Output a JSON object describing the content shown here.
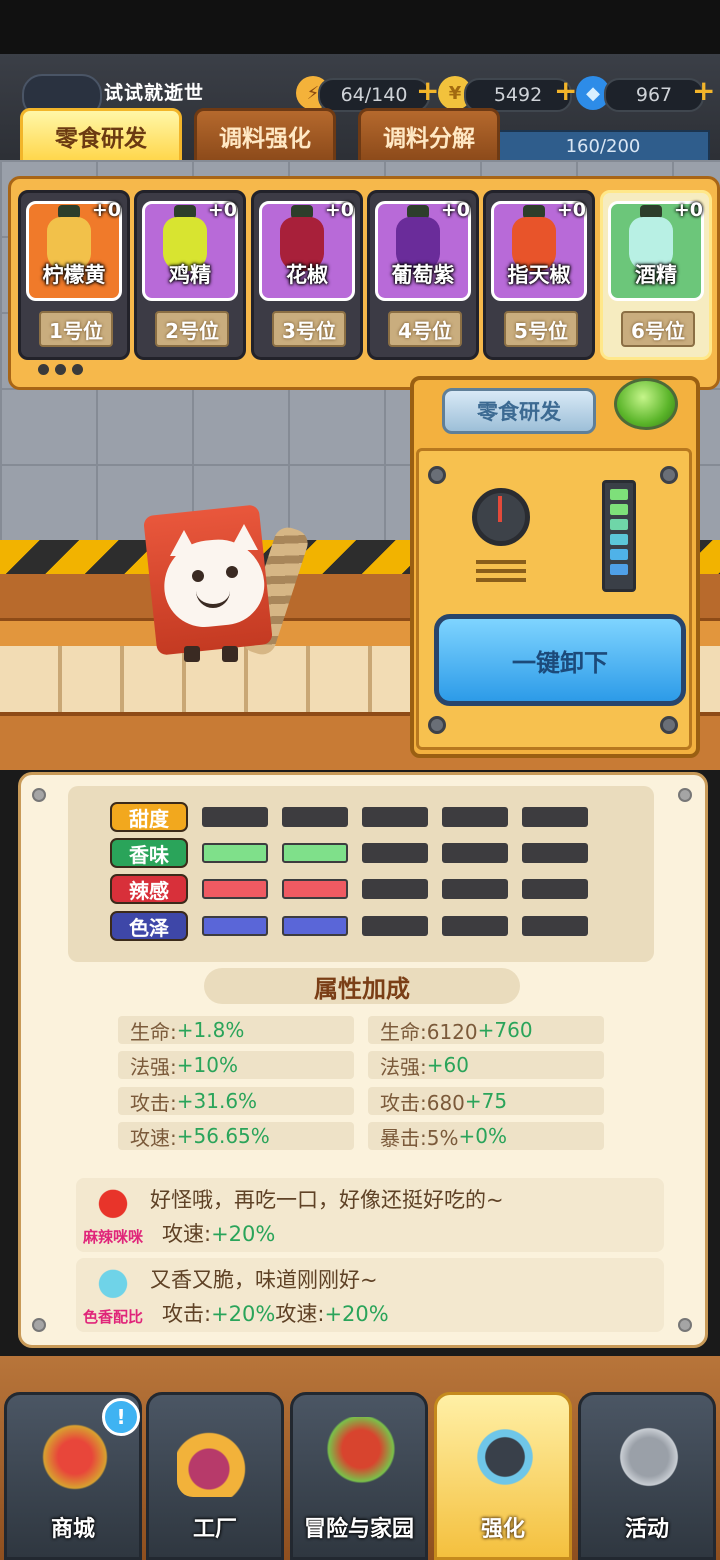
{
  "player": {
    "name": "试试就逝世"
  },
  "resources": {
    "stamina": "64/140",
    "gold": "5492",
    "diamond": "967",
    "progress": "160/200"
  },
  "tabs": [
    {
      "label": "零食研发",
      "active": true
    },
    {
      "label": "调料强化",
      "active": false
    },
    {
      "label": "调料分解",
      "active": false
    }
  ],
  "slots": [
    {
      "name": "柠檬黄",
      "plus": "+0",
      "position": "1号位",
      "color": "#f07a2a",
      "bottle": "#f2c14a"
    },
    {
      "name": "鸡精",
      "plus": "+0",
      "position": "2号位",
      "color": "#b86ad8",
      "bottle": "#d8e430"
    },
    {
      "name": "花椒",
      "plus": "+0",
      "position": "3号位",
      "color": "#b86ad8",
      "bottle": "#a8203a"
    },
    {
      "name": "葡萄紫",
      "plus": "+0",
      "position": "4号位",
      "color": "#b86ad8",
      "bottle": "#6a2c9a"
    },
    {
      "name": "指天椒",
      "plus": "+0",
      "position": "5号位",
      "color": "#b86ad8",
      "bottle": "#e8542a"
    },
    {
      "name": "酒精",
      "plus": "+0",
      "position": "6号位",
      "color": "#6cc67a",
      "bottle": "#b8f0e4"
    }
  ],
  "machine": {
    "label": "零食研发",
    "unload_button": "一键卸下"
  },
  "stats": [
    {
      "label": "甜度",
      "color": "#f2a81e",
      "filled": 0,
      "fill_color": "#7fe08a"
    },
    {
      "label": "香味",
      "color": "#2aa45a",
      "filled": 2,
      "fill_color": "#7fe08a"
    },
    {
      "label": "辣感",
      "color": "#d8303a",
      "filled": 2,
      "fill_color": "#ef5a62"
    },
    {
      "label": "色泽",
      "color": "#3e47a8",
      "filled": 2,
      "fill_color": "#5a66d8"
    }
  ],
  "bonus": {
    "title": "属性加成",
    "left": [
      {
        "key": "生命:",
        "value": "+1.8%"
      },
      {
        "key": "法强:",
        "value": "+10%"
      },
      {
        "key": "攻击:",
        "value": "+31.6%"
      },
      {
        "key": "攻速:",
        "value": "+56.65%"
      }
    ],
    "right": [
      {
        "key": "生命:6120",
        "value": "+760"
      },
      {
        "key": "法强:",
        "value": "+60"
      },
      {
        "key": "攻击:680",
        "value": "+75"
      },
      {
        "key": "暴击:5%",
        "value": "+0%"
      }
    ]
  },
  "combos": [
    {
      "name": "麻辣咪咪",
      "text": "好怪哦，再吃一口，好像还挺好吃的~",
      "eff_key": "攻速:",
      "eff_val": "+20%",
      "eff_key2": "",
      "eff_val2": ""
    },
    {
      "name": "色香配比",
      "text": "又香又脆，味道刚刚好~",
      "eff_key": "攻击:",
      "eff_val": "+20%",
      "eff_key2": "攻速:",
      "eff_val2": "+20%"
    }
  ],
  "nav": [
    {
      "label": "商城",
      "active": false
    },
    {
      "label": "工厂",
      "active": false
    },
    {
      "label": "冒险与家园",
      "active": false
    },
    {
      "label": "强化",
      "active": true
    },
    {
      "label": "活动",
      "active": false
    }
  ],
  "badge": "!"
}
